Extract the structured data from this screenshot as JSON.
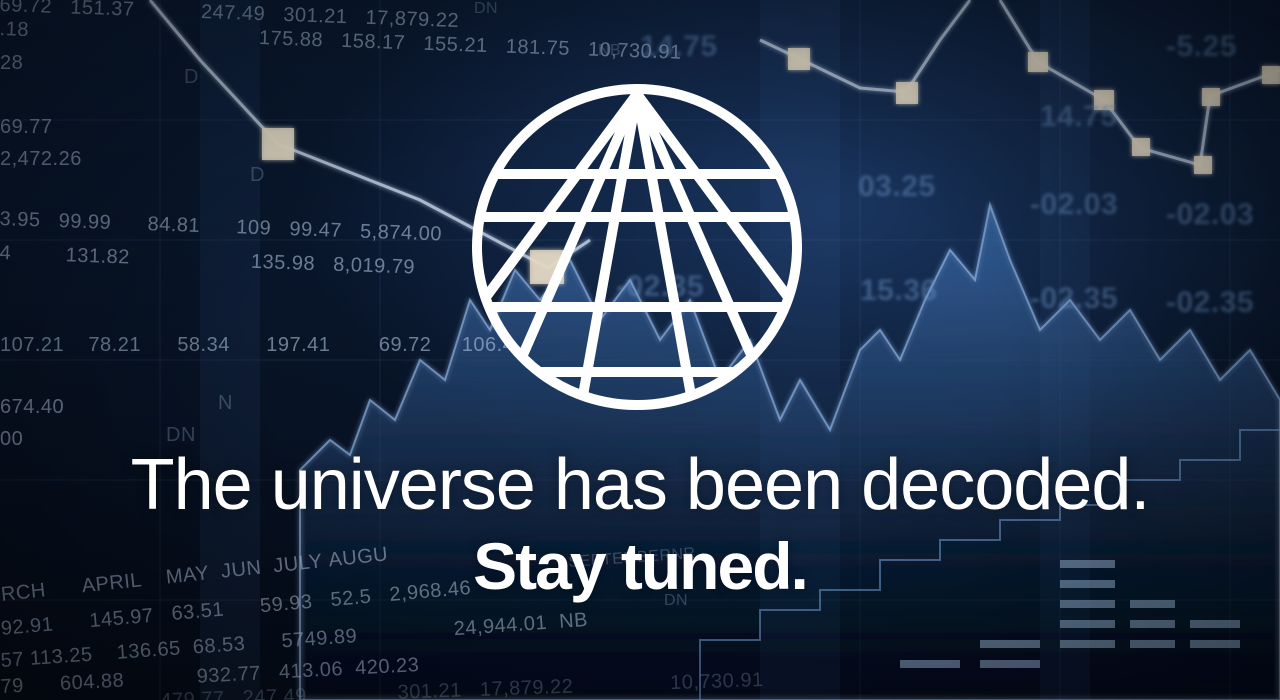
{
  "hero": {
    "headline": "The universe has been decoded.",
    "subline": "Stay tuned."
  },
  "logo": {
    "icon": "globe-grid-icon",
    "color": "#ffffff"
  },
  "background": {
    "tickers": [
      "69.72",
      "151.37",
      "247.49",
      "301.21",
      "17,879.22",
      "DN",
      ".18",
      "175.88",
      "158.17",
      "155.21",
      "181.75",
      "10,730.91",
      "NB",
      "28",
      "D",
      "69.77",
      "2,472.26",
      "D",
      "3.95",
      "99.99",
      "84.81",
      "109",
      "99.47",
      "5,874.00",
      "4",
      "131.82",
      "135.98",
      "8,019.79",
      "107.21",
      "78.21",
      "58.34",
      "197.41",
      "69.72",
      "106.4",
      "674.40",
      "N",
      "00",
      "DN",
      "RCH",
      "APRIL",
      "MAY",
      "JUN",
      "JULY",
      "AUGU",
      "SEPTEMBER",
      "NR",
      "92.91",
      "145.97",
      "63.51",
      "59.93",
      "52.5",
      "2,968.46",
      "57",
      "113.25",
      "136.65",
      "68.53",
      "5749.89",
      "24,944.01",
      "NB",
      "79",
      "604.88",
      "932.77",
      "413.06",
      "420.23",
      "DN",
      "479.77",
      "247.49",
      "301.21",
      "17,879.22",
      "10,730.91",
      "03.25",
      "-02.03",
      "-02.03",
      "15.36",
      "-02.35",
      "-02.35",
      "14.75",
      "14.75",
      "-5.25",
      "-02.35"
    ]
  }
}
